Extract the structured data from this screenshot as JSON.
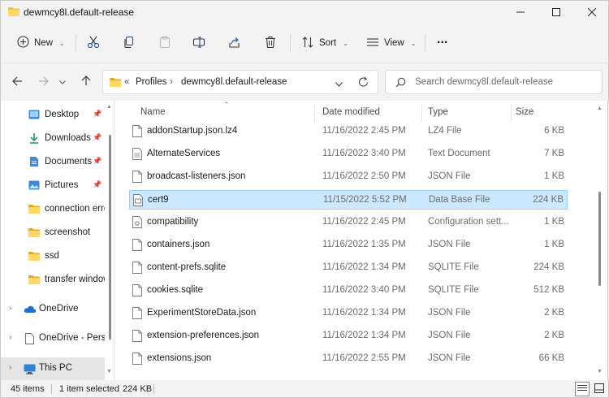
{
  "window": {
    "title": "dewmcy8l.default-release"
  },
  "toolbar": {
    "new_label": "New",
    "sort_label": "Sort",
    "view_label": "View",
    "more_label": "..."
  },
  "address": {
    "overflow": "«",
    "crumbs": [
      "Profiles",
      "dewmcy8l.default-release"
    ],
    "search_placeholder": "Search dewmcy8l.default-release"
  },
  "nav": {
    "items": [
      {
        "label": "Desktop",
        "pinned": true
      },
      {
        "label": "Downloads",
        "pinned": true
      },
      {
        "label": "Documents",
        "pinned": true
      },
      {
        "label": "Pictures",
        "pinned": true
      },
      {
        "label": "connection erro"
      },
      {
        "label": "screenshot"
      },
      {
        "label": "ssd"
      },
      {
        "label": "transfer window"
      },
      {
        "label": "OneDrive"
      },
      {
        "label": "OneDrive - Perso"
      },
      {
        "label": "This PC"
      }
    ]
  },
  "columns": {
    "name": "Name",
    "date": "Date modified",
    "type": "Type",
    "size": "Size"
  },
  "files": [
    {
      "name": "addonStartup.json.lz4",
      "date": "11/16/2022 2:45 PM",
      "type": "LZ4 File",
      "size": "6 KB"
    },
    {
      "name": "AlternateServices",
      "date": "11/16/2022 3:40 PM",
      "type": "Text Document",
      "size": "7 KB"
    },
    {
      "name": "broadcast-listeners.json",
      "date": "11/16/2022 2:50 PM",
      "type": "JSON File",
      "size": "1 KB"
    },
    {
      "name": "cert9",
      "date": "11/15/2022 5:52 PM",
      "type": "Data Base File",
      "size": "224 KB"
    },
    {
      "name": "compatibility",
      "date": "11/16/2022 2:45 PM",
      "type": "Configuration sett...",
      "size": "1 KB"
    },
    {
      "name": "containers.json",
      "date": "11/16/2022 1:35 PM",
      "type": "JSON File",
      "size": "1 KB"
    },
    {
      "name": "content-prefs.sqlite",
      "date": "11/16/2022 1:34 PM",
      "type": "SQLITE File",
      "size": "224 KB"
    },
    {
      "name": "cookies.sqlite",
      "date": "11/16/2022 3:40 PM",
      "type": "SQLITE File",
      "size": "512 KB"
    },
    {
      "name": "ExperimentStoreData.json",
      "date": "11/16/2022 1:34 PM",
      "type": "JSON File",
      "size": "2 KB"
    },
    {
      "name": "extension-preferences.json",
      "date": "11/16/2022 1:34 PM",
      "type": "JSON File",
      "size": "2 KB"
    },
    {
      "name": "extensions.json",
      "date": "11/16/2022 2:55 PM",
      "type": "JSON File",
      "size": "66 KB"
    }
  ],
  "status": {
    "items": "45 items",
    "selected": "1 item selected",
    "selected_size": "224 KB"
  }
}
